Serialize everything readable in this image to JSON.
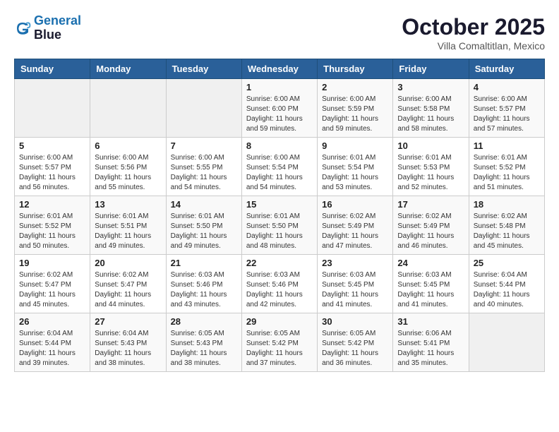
{
  "header": {
    "logo_line1": "General",
    "logo_line2": "Blue",
    "month": "October 2025",
    "location": "Villa Comaltitlan, Mexico"
  },
  "weekdays": [
    "Sunday",
    "Monday",
    "Tuesday",
    "Wednesday",
    "Thursday",
    "Friday",
    "Saturday"
  ],
  "weeks": [
    [
      {
        "day": "",
        "sunrise": "",
        "sunset": "",
        "daylight": ""
      },
      {
        "day": "",
        "sunrise": "",
        "sunset": "",
        "daylight": ""
      },
      {
        "day": "",
        "sunrise": "",
        "sunset": "",
        "daylight": ""
      },
      {
        "day": "1",
        "sunrise": "Sunrise: 6:00 AM",
        "sunset": "Sunset: 6:00 PM",
        "daylight": "Daylight: 11 hours and 59 minutes."
      },
      {
        "day": "2",
        "sunrise": "Sunrise: 6:00 AM",
        "sunset": "Sunset: 5:59 PM",
        "daylight": "Daylight: 11 hours and 59 minutes."
      },
      {
        "day": "3",
        "sunrise": "Sunrise: 6:00 AM",
        "sunset": "Sunset: 5:58 PM",
        "daylight": "Daylight: 11 hours and 58 minutes."
      },
      {
        "day": "4",
        "sunrise": "Sunrise: 6:00 AM",
        "sunset": "Sunset: 5:57 PM",
        "daylight": "Daylight: 11 hours and 57 minutes."
      }
    ],
    [
      {
        "day": "5",
        "sunrise": "Sunrise: 6:00 AM",
        "sunset": "Sunset: 5:57 PM",
        "daylight": "Daylight: 11 hours and 56 minutes."
      },
      {
        "day": "6",
        "sunrise": "Sunrise: 6:00 AM",
        "sunset": "Sunset: 5:56 PM",
        "daylight": "Daylight: 11 hours and 55 minutes."
      },
      {
        "day": "7",
        "sunrise": "Sunrise: 6:00 AM",
        "sunset": "Sunset: 5:55 PM",
        "daylight": "Daylight: 11 hours and 54 minutes."
      },
      {
        "day": "8",
        "sunrise": "Sunrise: 6:00 AM",
        "sunset": "Sunset: 5:54 PM",
        "daylight": "Daylight: 11 hours and 54 minutes."
      },
      {
        "day": "9",
        "sunrise": "Sunrise: 6:01 AM",
        "sunset": "Sunset: 5:54 PM",
        "daylight": "Daylight: 11 hours and 53 minutes."
      },
      {
        "day": "10",
        "sunrise": "Sunrise: 6:01 AM",
        "sunset": "Sunset: 5:53 PM",
        "daylight": "Daylight: 11 hours and 52 minutes."
      },
      {
        "day": "11",
        "sunrise": "Sunrise: 6:01 AM",
        "sunset": "Sunset: 5:52 PM",
        "daylight": "Daylight: 11 hours and 51 minutes."
      }
    ],
    [
      {
        "day": "12",
        "sunrise": "Sunrise: 6:01 AM",
        "sunset": "Sunset: 5:52 PM",
        "daylight": "Daylight: 11 hours and 50 minutes."
      },
      {
        "day": "13",
        "sunrise": "Sunrise: 6:01 AM",
        "sunset": "Sunset: 5:51 PM",
        "daylight": "Daylight: 11 hours and 49 minutes."
      },
      {
        "day": "14",
        "sunrise": "Sunrise: 6:01 AM",
        "sunset": "Sunset: 5:50 PM",
        "daylight": "Daylight: 11 hours and 49 minutes."
      },
      {
        "day": "15",
        "sunrise": "Sunrise: 6:01 AM",
        "sunset": "Sunset: 5:50 PM",
        "daylight": "Daylight: 11 hours and 48 minutes."
      },
      {
        "day": "16",
        "sunrise": "Sunrise: 6:02 AM",
        "sunset": "Sunset: 5:49 PM",
        "daylight": "Daylight: 11 hours and 47 minutes."
      },
      {
        "day": "17",
        "sunrise": "Sunrise: 6:02 AM",
        "sunset": "Sunset: 5:49 PM",
        "daylight": "Daylight: 11 hours and 46 minutes."
      },
      {
        "day": "18",
        "sunrise": "Sunrise: 6:02 AM",
        "sunset": "Sunset: 5:48 PM",
        "daylight": "Daylight: 11 hours and 45 minutes."
      }
    ],
    [
      {
        "day": "19",
        "sunrise": "Sunrise: 6:02 AM",
        "sunset": "Sunset: 5:47 PM",
        "daylight": "Daylight: 11 hours and 45 minutes."
      },
      {
        "day": "20",
        "sunrise": "Sunrise: 6:02 AM",
        "sunset": "Sunset: 5:47 PM",
        "daylight": "Daylight: 11 hours and 44 minutes."
      },
      {
        "day": "21",
        "sunrise": "Sunrise: 6:03 AM",
        "sunset": "Sunset: 5:46 PM",
        "daylight": "Daylight: 11 hours and 43 minutes."
      },
      {
        "day": "22",
        "sunrise": "Sunrise: 6:03 AM",
        "sunset": "Sunset: 5:46 PM",
        "daylight": "Daylight: 11 hours and 42 minutes."
      },
      {
        "day": "23",
        "sunrise": "Sunrise: 6:03 AM",
        "sunset": "Sunset: 5:45 PM",
        "daylight": "Daylight: 11 hours and 41 minutes."
      },
      {
        "day": "24",
        "sunrise": "Sunrise: 6:03 AM",
        "sunset": "Sunset: 5:45 PM",
        "daylight": "Daylight: 11 hours and 41 minutes."
      },
      {
        "day": "25",
        "sunrise": "Sunrise: 6:04 AM",
        "sunset": "Sunset: 5:44 PM",
        "daylight": "Daylight: 11 hours and 40 minutes."
      }
    ],
    [
      {
        "day": "26",
        "sunrise": "Sunrise: 6:04 AM",
        "sunset": "Sunset: 5:44 PM",
        "daylight": "Daylight: 11 hours and 39 minutes."
      },
      {
        "day": "27",
        "sunrise": "Sunrise: 6:04 AM",
        "sunset": "Sunset: 5:43 PM",
        "daylight": "Daylight: 11 hours and 38 minutes."
      },
      {
        "day": "28",
        "sunrise": "Sunrise: 6:05 AM",
        "sunset": "Sunset: 5:43 PM",
        "daylight": "Daylight: 11 hours and 38 minutes."
      },
      {
        "day": "29",
        "sunrise": "Sunrise: 6:05 AM",
        "sunset": "Sunset: 5:42 PM",
        "daylight": "Daylight: 11 hours and 37 minutes."
      },
      {
        "day": "30",
        "sunrise": "Sunrise: 6:05 AM",
        "sunset": "Sunset: 5:42 PM",
        "daylight": "Daylight: 11 hours and 36 minutes."
      },
      {
        "day": "31",
        "sunrise": "Sunrise: 6:06 AM",
        "sunset": "Sunset: 5:41 PM",
        "daylight": "Daylight: 11 hours and 35 minutes."
      },
      {
        "day": "",
        "sunrise": "",
        "sunset": "",
        "daylight": ""
      }
    ]
  ]
}
